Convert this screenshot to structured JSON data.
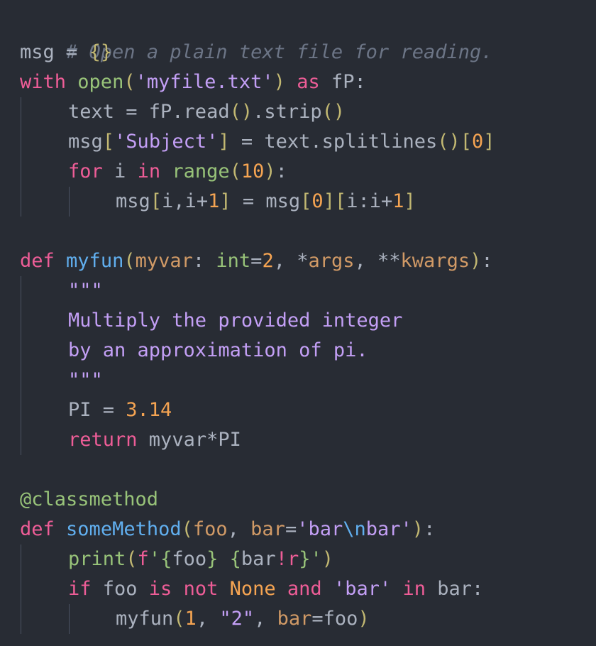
{
  "lines": {
    "l1": {
      "comment": "# Open a plain text file for reading."
    },
    "l2": {
      "a": "msg",
      "b": " = ",
      "c": "{}"
    },
    "l3": {
      "kw1": "with",
      "sp1": " ",
      "fn": "open",
      "p1": "(",
      "str": "'myfile.txt'",
      "p2": ")",
      "sp2": " ",
      "kw2": "as",
      "rest": " fP:"
    },
    "l4": {
      "a": "text = fP.read",
      "p1": "()",
      "b": ".strip",
      "p2": "()"
    },
    "l5": {
      "a": "msg",
      "p1": "[",
      "str": "'Subject'",
      "p2": "]",
      "b": " = text.splitlines",
      "p3": "()",
      "p4": "[",
      "num": "0",
      "p5": "]"
    },
    "l6": {
      "kw1": "for",
      "a": " i ",
      "kw2": "in",
      "sp": " ",
      "fn": "range",
      "p1": "(",
      "num": "10",
      "p2": ")",
      "b": ":"
    },
    "l7": {
      "a": "msg",
      "p1": "[",
      "b": "i,i+",
      "num1": "1",
      "p2": "]",
      "c": " = msg",
      "p3": "[",
      "num2": "0",
      "p4": "]",
      "p5": "[",
      "d": "i:i+",
      "num3": "1",
      "p6": "]"
    },
    "l9": {
      "kw": "def",
      "sp": " ",
      "fn": "myfun",
      "p1": "(",
      "param1": "myvar",
      "a": ": ",
      "type": "int",
      "b": "=",
      "num": "2",
      "c": ", *",
      "param2": "args",
      "d": ", **",
      "param3": "kwargs",
      "p2": ")",
      "e": ":"
    },
    "l10": {
      "doc": "\"\"\""
    },
    "l11": {
      "doc": "Multiply the provided integer"
    },
    "l12": {
      "doc": "by an approximation of pi."
    },
    "l13": {
      "doc": "\"\"\""
    },
    "l14": {
      "a": "PI = ",
      "num": "3.14"
    },
    "l15": {
      "kw": "return",
      "a": " myvar*PI"
    },
    "l17": {
      "deco": "@classmethod"
    },
    "l18": {
      "kw": "def",
      "sp": " ",
      "fn": "someMethod",
      "p1": "(",
      "param1": "foo",
      "a": ", ",
      "param2": "bar",
      "b": "=",
      "str1": "'bar",
      "esc": "\\n",
      "str2": "bar'",
      "p2": ")",
      "c": ":"
    },
    "l19": {
      "fn": "print",
      "p1": "(",
      "fpre": "f",
      "s1": "'",
      "b1": "{",
      "v1": "foo",
      "b2": "}",
      "s2": " ",
      "b3": "{",
      "v2": "bar",
      "bang": "!",
      "conv": "r",
      "b4": "}",
      "s3": "'",
      "p2": ")"
    },
    "l20": {
      "kw1": "if",
      "a": " foo ",
      "kw2": "is",
      "sp1": " ",
      "kw3": "not",
      "sp2": " ",
      "const": "None",
      "sp3": " ",
      "kw4": "and",
      "sp4": " ",
      "str": "'bar'",
      "sp5": " ",
      "kw5": "in",
      "b": " bar:"
    },
    "l21": {
      "a": "myfun",
      "p1": "(",
      "num": "1",
      "b": ", ",
      "str": "\"2\"",
      "c": ", ",
      "param": "bar",
      "d": "=foo",
      "p2": ")"
    }
  },
  "colors": {
    "background": "#282c34",
    "keyword": "#ee5d97",
    "function": "#61afef",
    "builtin": "#98c379",
    "string": "#c39ff5",
    "number": "#f5a452",
    "param": "#d19a66",
    "comment": "#6c7586"
  }
}
